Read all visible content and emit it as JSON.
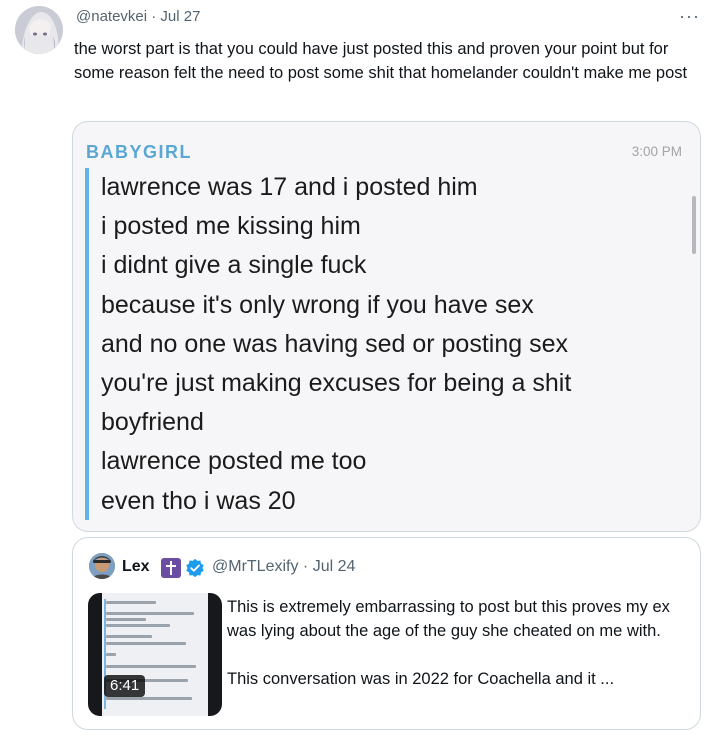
{
  "tweet": {
    "handle_line": "@natevkei · Jul 27",
    "more_glyph": "···",
    "avatar_icon": "anime-avatar",
    "text": "the worst part is that you could have just posted this and proven your point but for some reason felt the need to post some shit that homelander couldn't make me post"
  },
  "media": {
    "sender": "BABYGIRL",
    "time": "3:00 PM",
    "lines": [
      "lawrence was 17 and i posted him",
      "i posted me kissing him",
      "i didnt give a single fuck",
      "because it's only wrong if you have sex",
      "and no one was having sed or posting sex",
      "you're just making excuses for being a shit",
      "boyfriend",
      "lawrence posted me too",
      "even tho i was 20"
    ],
    "accent_color": "#5aa7d4"
  },
  "quote": {
    "name": "Lex",
    "badge_icon": "latin-cross-icon",
    "verified_icon": "verified-badge-icon",
    "verified_color": "#1d9bf0",
    "meta": "@MrTLexify · Jul 24",
    "video_duration": "6:41",
    "text_line1": "This is extremely embarrassing to post but this proves my ex was lying about the age of the guy she cheated on me with.",
    "text_line2": "This conversation was in 2022 for Coachella and it ..."
  }
}
